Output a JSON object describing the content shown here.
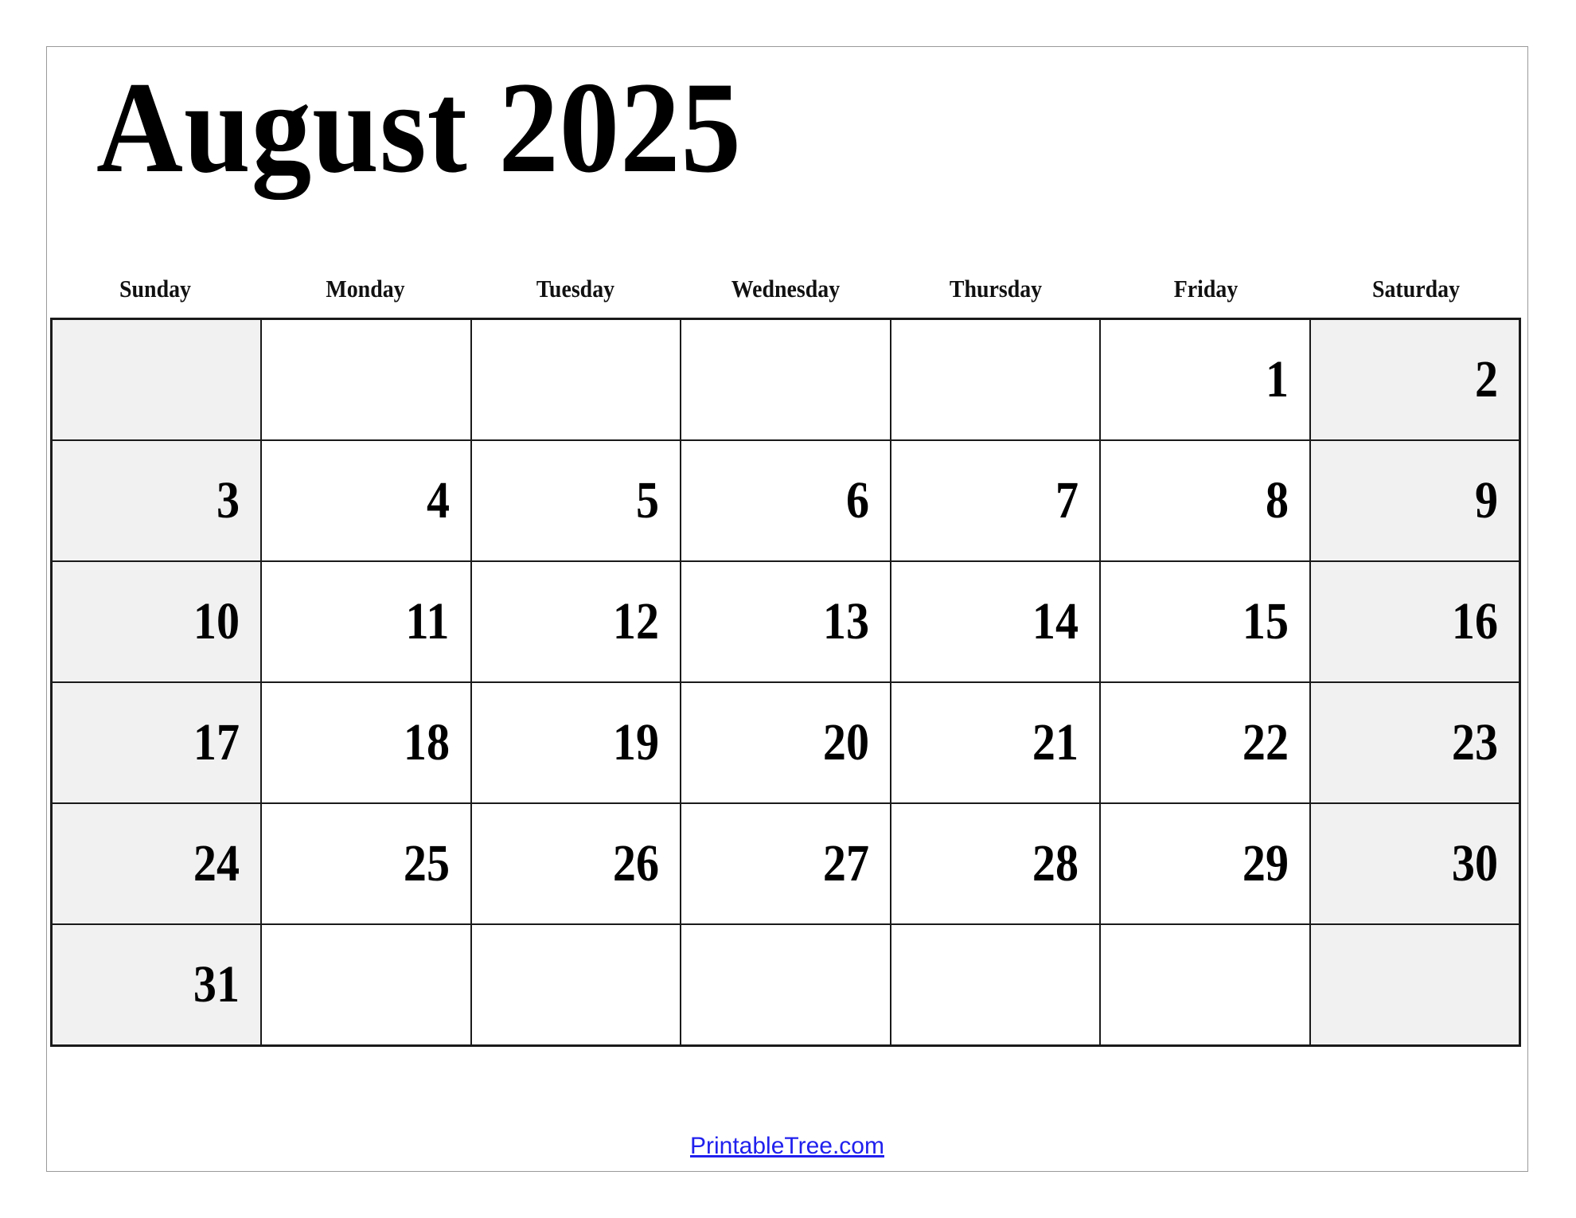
{
  "document": {
    "title": "August 2025",
    "month": "August",
    "year": "2025"
  },
  "weekdays": [
    {
      "label": "Sunday",
      "weekend": true
    },
    {
      "label": "Monday",
      "weekend": false
    },
    {
      "label": "Tuesday",
      "weekend": false
    },
    {
      "label": "Wednesday",
      "weekend": false
    },
    {
      "label": "Thursday",
      "weekend": false
    },
    {
      "label": "Friday",
      "weekend": false
    },
    {
      "label": "Saturday",
      "weekend": true
    }
  ],
  "weeks": [
    [
      {
        "day": ""
      },
      {
        "day": ""
      },
      {
        "day": ""
      },
      {
        "day": ""
      },
      {
        "day": ""
      },
      {
        "day": "1"
      },
      {
        "day": "2"
      }
    ],
    [
      {
        "day": "3"
      },
      {
        "day": "4"
      },
      {
        "day": "5"
      },
      {
        "day": "6"
      },
      {
        "day": "7"
      },
      {
        "day": "8"
      },
      {
        "day": "9"
      }
    ],
    [
      {
        "day": "10"
      },
      {
        "day": "11"
      },
      {
        "day": "12"
      },
      {
        "day": "13"
      },
      {
        "day": "14"
      },
      {
        "day": "15"
      },
      {
        "day": "16"
      }
    ],
    [
      {
        "day": "17"
      },
      {
        "day": "18"
      },
      {
        "day": "19"
      },
      {
        "day": "20"
      },
      {
        "day": "21"
      },
      {
        "day": "22"
      },
      {
        "day": "23"
      }
    ],
    [
      {
        "day": "24"
      },
      {
        "day": "25"
      },
      {
        "day": "26"
      },
      {
        "day": "27"
      },
      {
        "day": "28"
      },
      {
        "day": "29"
      },
      {
        "day": "30"
      }
    ],
    [
      {
        "day": "31"
      },
      {
        "day": ""
      },
      {
        "day": ""
      },
      {
        "day": ""
      },
      {
        "day": ""
      },
      {
        "day": ""
      },
      {
        "day": ""
      }
    ]
  ],
  "footer": {
    "link_text": "PrintableTree.com"
  },
  "colors": {
    "weekend_background": "#f1f1f1",
    "grid_line": "#1a1a1a",
    "page_border": "#9a9a9a",
    "link": "#2020ee",
    "text": "#000000"
  }
}
